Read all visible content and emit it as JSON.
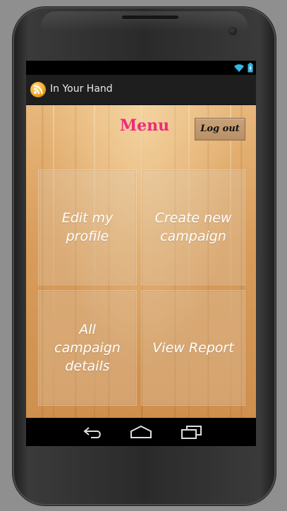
{
  "app": {
    "title": "In Your Hand"
  },
  "menu": {
    "title": "Menu",
    "logout_label": "Log out"
  },
  "tiles": [
    {
      "label": "Edit my profile"
    },
    {
      "label": "Create new campaign"
    },
    {
      "label": "All campaign details"
    },
    {
      "label": "View Report"
    }
  ],
  "colors": {
    "menu_title": "#ec2b7d",
    "status_icons": "#33b5e5"
  },
  "icons": {
    "status": [
      "wifi-icon",
      "battery-icon"
    ],
    "navigation": [
      "back-icon",
      "home-icon",
      "recent-apps-icon"
    ]
  }
}
